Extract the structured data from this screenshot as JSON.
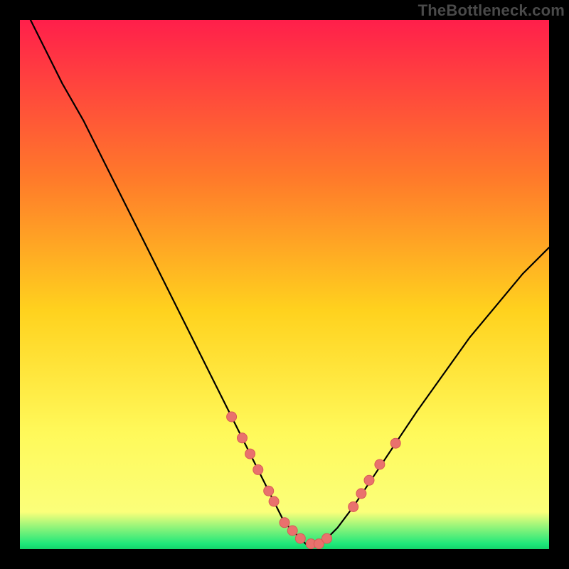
{
  "watermark": "TheBottleneck.com",
  "colors": {
    "frame": "#000000",
    "grad_top": "#ff1f4b",
    "grad_mid1": "#ff7a2a",
    "grad_mid2": "#ffd21e",
    "grad_mid3": "#fff95a",
    "grad_green": "#1ee87a",
    "curve": "#000000",
    "dot_fill": "#e9716d",
    "dot_stroke": "#d85a56"
  },
  "chart_data": {
    "type": "line",
    "title": "",
    "xlabel": "",
    "ylabel": "",
    "xlim": [
      0,
      100
    ],
    "ylim": [
      0,
      100
    ],
    "series": [
      {
        "name": "bottleneck-curve",
        "x": [
          2,
          5,
          8,
          12,
          16,
          20,
          24,
          28,
          32,
          36,
          40,
          43,
          46,
          48,
          50,
          52,
          54,
          56,
          58,
          60,
          63,
          67,
          71,
          75,
          80,
          85,
          90,
          95,
          100
        ],
        "y": [
          100,
          94,
          88,
          81,
          73,
          65,
          57,
          49,
          41,
          33,
          25,
          19,
          13,
          9,
          5,
          3,
          1,
          1,
          2,
          4,
          8,
          14,
          20,
          26,
          33,
          40,
          46,
          52,
          57
        ]
      }
    ],
    "points": {
      "name": "marked-points",
      "x": [
        40,
        42,
        43.5,
        45,
        47,
        48,
        50,
        51.5,
        53,
        55,
        56.5,
        58,
        63,
        64.5,
        66,
        68,
        71
      ],
      "y": [
        25,
        21,
        18,
        15,
        11,
        9,
        5,
        3.5,
        2,
        1,
        1,
        2,
        8,
        10.5,
        13,
        16,
        20
      ]
    }
  }
}
